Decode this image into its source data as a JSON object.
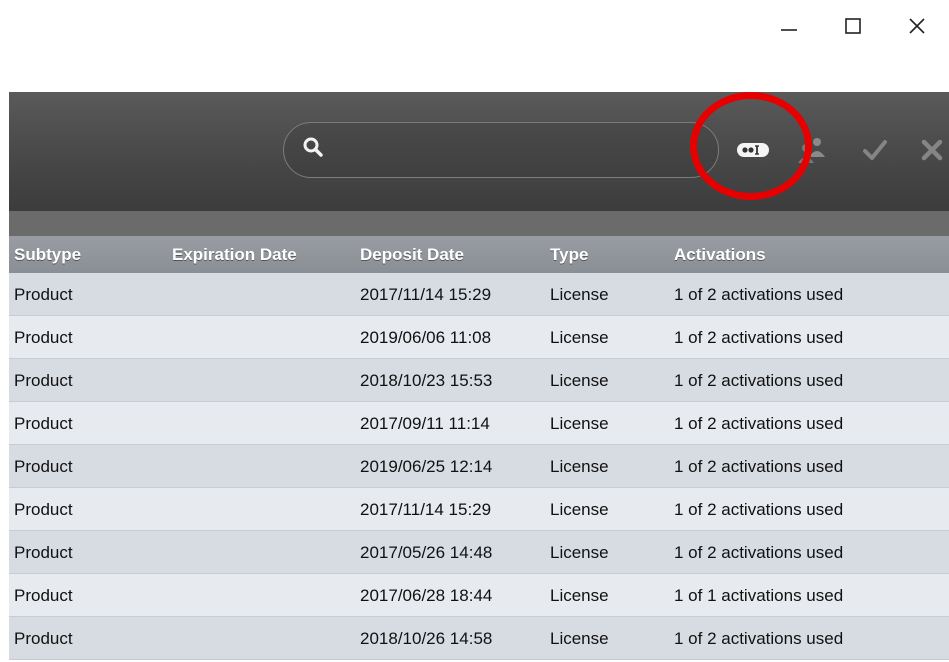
{
  "window": {
    "minimize_icon": "minimize-icon",
    "maximize_icon": "maximize-icon",
    "close_icon": "close-icon"
  },
  "toolbar": {
    "search_value": "",
    "search_placeholder": "",
    "tools": [
      "password-dots-icon",
      "users-icon",
      "checkmark-icon",
      "cross-icon"
    ],
    "highlight_color": "#e60000"
  },
  "table": {
    "columns": [
      "Subtype",
      "Expiration Date",
      "Deposit Date",
      "Type",
      "Activations"
    ],
    "rows": [
      [
        "Product",
        "",
        "2017/11/14 15:29",
        "License",
        "1 of 2 activations used"
      ],
      [
        "Product",
        "",
        "2019/06/06 11:08",
        "License",
        "1 of 2 activations used"
      ],
      [
        "Product",
        "",
        "2018/10/23 15:53",
        "License",
        "1 of 2 activations used"
      ],
      [
        "Product",
        "",
        "2017/09/11 11:14",
        "License",
        "1 of 2 activations used"
      ],
      [
        "Product",
        "",
        "2019/06/25 12:14",
        "License",
        "1 of 2 activations used"
      ],
      [
        "Product",
        "",
        "2017/11/14 15:29",
        "License",
        "1 of 2 activations used"
      ],
      [
        "Product",
        "",
        "2017/05/26 14:48",
        "License",
        "1 of 2 activations used"
      ],
      [
        "Product",
        "",
        "2017/06/28 18:44",
        "License",
        "1 of 1 activations used"
      ],
      [
        "Product",
        "",
        "2018/10/26 14:58",
        "License",
        "1 of 2 activations used"
      ]
    ]
  }
}
